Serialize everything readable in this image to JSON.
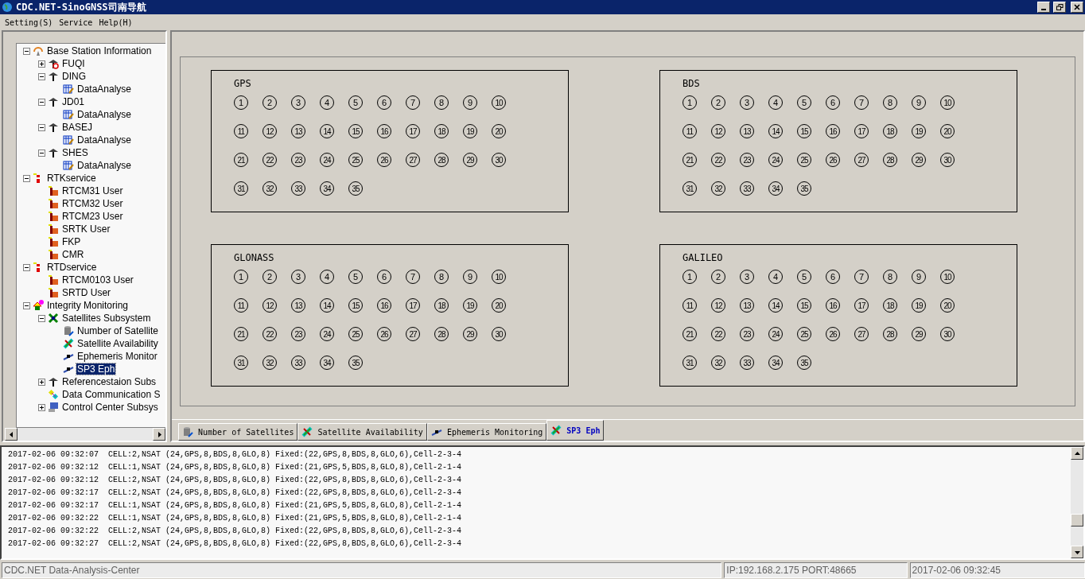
{
  "window": {
    "title": "CDC.NET-SinoGNSS司南导航"
  },
  "menu": [
    "Setting(S)",
    "Service",
    "Help(H)"
  ],
  "tree": [
    {
      "label": "Base Station Information",
      "kind": "network",
      "expanded": true,
      "selected": false,
      "children": [
        {
          "label": "FUQI",
          "kind": "station-off",
          "expanded": false,
          "selected": false
        },
        {
          "label": "DING",
          "kind": "station",
          "expanded": true,
          "selected": false,
          "children": [
            {
              "label": "DataAnalyse",
              "kind": "data",
              "selected": false
            }
          ]
        },
        {
          "label": "JD01",
          "kind": "station",
          "expanded": true,
          "selected": false,
          "children": [
            {
              "label": "DataAnalyse",
              "kind": "data",
              "selected": false
            }
          ]
        },
        {
          "label": "BASEJ",
          "kind": "station",
          "expanded": true,
          "selected": false,
          "children": [
            {
              "label": "DataAnalyse",
              "kind": "data",
              "selected": false
            }
          ]
        },
        {
          "label": "SHES",
          "kind": "station",
          "expanded": true,
          "selected": false,
          "children": [
            {
              "label": "DataAnalyse",
              "kind": "data",
              "selected": false
            }
          ]
        }
      ]
    },
    {
      "label": "RTKservice",
      "kind": "tower",
      "expanded": true,
      "selected": false,
      "children": [
        {
          "label": "RTCM31 User",
          "kind": "user",
          "selected": false
        },
        {
          "label": "RTCM32 User",
          "kind": "user",
          "selected": false
        },
        {
          "label": "RTCM23 User",
          "kind": "user",
          "selected": false
        },
        {
          "label": "SRTK User",
          "kind": "user",
          "selected": false
        },
        {
          "label": "FKP",
          "kind": "user",
          "selected": false
        },
        {
          "label": "CMR",
          "kind": "user",
          "selected": false
        }
      ]
    },
    {
      "label": "RTDservice",
      "kind": "tower",
      "expanded": true,
      "selected": false,
      "children": [
        {
          "label": "RTCM0103 User",
          "kind": "user",
          "selected": false
        },
        {
          "label": "SRTD User",
          "kind": "user",
          "selected": false
        }
      ]
    },
    {
      "label": "Integrity Monitoring",
      "kind": "shapes",
      "expanded": true,
      "selected": false,
      "children": [
        {
          "label": "Satellites Subsystem",
          "kind": "satellite",
          "expanded": true,
          "selected": false,
          "children": [
            {
              "label": "Number of Satellite",
              "kind": "database",
              "selected": false
            },
            {
              "label": "Satellite Availability",
              "kind": "satellite-alt",
              "selected": false
            },
            {
              "label": "Ephemeris Monitor",
              "kind": "orbit",
              "selected": false
            },
            {
              "label": "SP3 Eph",
              "kind": "orbit",
              "selected": true
            }
          ]
        },
        {
          "label": "Referencestaion Subs",
          "kind": "station",
          "expanded": false,
          "selected": false
        },
        {
          "label": "Data Communication S",
          "kind": "link",
          "selected": false
        },
        {
          "label": "Control Center Subsys",
          "kind": "computer",
          "expanded": false,
          "selected": false
        }
      ]
    }
  ],
  "constellations": [
    {
      "name": "GPS",
      "satellites": [
        "1",
        "2",
        "3",
        "4",
        "5",
        "6",
        "7",
        "8",
        "9",
        "10",
        "11",
        "12",
        "13",
        "14",
        "15",
        "16",
        "17",
        "18",
        "19",
        "20",
        "21",
        "22",
        "23",
        "24",
        "25",
        "26",
        "27",
        "28",
        "29",
        "30",
        "31",
        "32",
        "33",
        "34",
        "35"
      ]
    },
    {
      "name": "BDS",
      "satellites": [
        "1",
        "2",
        "3",
        "4",
        "5",
        "6",
        "7",
        "8",
        "9",
        "10",
        "11",
        "12",
        "13",
        "14",
        "15",
        "16",
        "17",
        "18",
        "19",
        "20",
        "21",
        "22",
        "23",
        "24",
        "25",
        "26",
        "27",
        "28",
        "29",
        "30",
        "31",
        "32",
        "33",
        "34",
        "35"
      ]
    },
    {
      "name": "GLONASS",
      "satellites": [
        "1",
        "2",
        "3",
        "4",
        "5",
        "6",
        "7",
        "8",
        "9",
        "10",
        "11",
        "12",
        "13",
        "14",
        "15",
        "16",
        "17",
        "18",
        "19",
        "20",
        "21",
        "22",
        "23",
        "24",
        "25",
        "26",
        "27",
        "28",
        "29",
        "30",
        "31",
        "32",
        "33",
        "34",
        "35"
      ]
    },
    {
      "name": "GALILEO",
      "satellites": [
        "1",
        "2",
        "3",
        "4",
        "5",
        "6",
        "7",
        "8",
        "9",
        "10",
        "11",
        "12",
        "13",
        "14",
        "15",
        "16",
        "17",
        "18",
        "19",
        "20",
        "21",
        "22",
        "23",
        "24",
        "25",
        "26",
        "27",
        "28",
        "29",
        "30",
        "31",
        "32",
        "33",
        "34",
        "35"
      ]
    }
  ],
  "tabs": [
    {
      "label": "Number of Satellites",
      "kind": "database",
      "selected": false
    },
    {
      "label": "Satellite Availability",
      "kind": "satellite-alt",
      "selected": false
    },
    {
      "label": "Ephemeris Monitoring",
      "kind": "orbit",
      "selected": false
    },
    {
      "label": "SP3 Eph",
      "kind": "satellite-alt",
      "selected": true
    }
  ],
  "log": [
    "2017-02-06 09:32:07  CELL:2,NSAT (24,GPS,8,BDS,8,GLO,8) Fixed:(22,GPS,8,BDS,8,GLO,6),Cell-2-3-4",
    "2017-02-06 09:32:12  CELL:1,NSAT (24,GPS,8,BDS,8,GLO,8) Fixed:(21,GPS,5,BDS,8,GLO,8),Cell-2-1-4",
    "2017-02-06 09:32:12  CELL:2,NSAT (24,GPS,8,BDS,8,GLO,8) Fixed:(22,GPS,8,BDS,8,GLO,6),Cell-2-3-4",
    "2017-02-06 09:32:17  CELL:2,NSAT (24,GPS,8,BDS,8,GLO,8) Fixed:(22,GPS,8,BDS,8,GLO,6),Cell-2-3-4",
    "2017-02-06 09:32:17  CELL:1,NSAT (24,GPS,8,BDS,8,GLO,8) Fixed:(21,GPS,5,BDS,8,GLO,8),Cell-2-1-4",
    "2017-02-06 09:32:22  CELL:1,NSAT (24,GPS,8,BDS,8,GLO,8) Fixed:(21,GPS,5,BDS,8,GLO,8),Cell-2-1-4",
    "2017-02-06 09:32:22  CELL:2,NSAT (24,GPS,8,BDS,8,GLO,8) Fixed:(22,GPS,8,BDS,8,GLO,6),Cell-2-3-4",
    "2017-02-06 09:32:27  CELL:2,NSAT (24,GPS,8,BDS,8,GLO,8) Fixed:(22,GPS,8,BDS,8,GLO,6),Cell-2-3-4"
  ],
  "status_bar": [
    "CDC.NET Data-Analysis-Center",
    "IP:192.168.2.175 PORT:48665",
    "2017-02-06 09:32:45"
  ]
}
